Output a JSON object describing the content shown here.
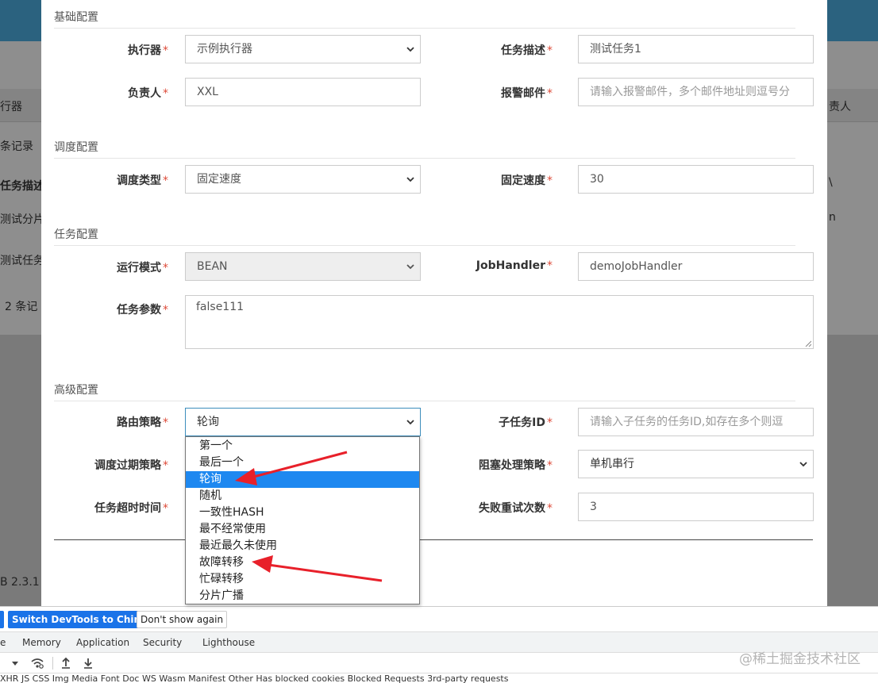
{
  "background": {
    "col_executor": "行器",
    "col_owner": "责人",
    "record_label": "条记录",
    "col_desc": "任务描述",
    "row1": "测试分片",
    "row1_right": "n",
    "row2": "测试任务",
    "row_right": "\\",
    "records_total": "2 条记",
    "version": "B 2.3.1"
  },
  "colors": {
    "accent": "#3c8dbc",
    "selected": "#1e88f0",
    "required": "#dd4b39",
    "arrow": "#e8202a"
  },
  "sections": {
    "basic": "基础配置",
    "schedule": "调度配置",
    "task": "任务配置",
    "advanced": "高级配置"
  },
  "form": {
    "executor": {
      "label": "执行器",
      "value": "示例执行器"
    },
    "task_desc": {
      "label": "任务描述",
      "value": "测试任务1"
    },
    "owner": {
      "label": "负责人",
      "value": "XXL"
    },
    "alarm_email": {
      "label": "报警邮件",
      "placeholder": "请输入报警邮件，多个邮件地址则逗号分"
    },
    "schedule_type": {
      "label": "调度类型",
      "value": "固定速度"
    },
    "fixed_rate": {
      "label": "固定速度",
      "value": "30"
    },
    "run_mode": {
      "label": "运行模式",
      "value": "BEAN"
    },
    "job_handler": {
      "label": "JobHandler",
      "value": "demoJobHandler"
    },
    "task_param": {
      "label": "任务参数",
      "value": "false111"
    },
    "route_strategy": {
      "label": "路由策略",
      "value": "轮询"
    },
    "child_job_id": {
      "label": "子任务ID",
      "placeholder": "请输入子任务的任务ID,如存在多个则逗"
    },
    "misfire_strategy": {
      "label": "调度过期策略"
    },
    "block_strategy": {
      "label": "阻塞处理策略",
      "value": "单机串行"
    },
    "timeout": {
      "label": "任务超时时间"
    },
    "fail_retry": {
      "label": "失败重试次数",
      "value": "3"
    },
    "required_mark": "*"
  },
  "route_options": [
    "第一个",
    "最后一个",
    "轮询",
    "随机",
    "一致性HASH",
    "最不经常使用",
    "最近最久未使用",
    "故障转移",
    "忙碌转移",
    "分片广播"
  ],
  "route_selected": "轮询",
  "devtools": {
    "switch_btn": "Switch DevTools to Chinese",
    "dont_show": "Don't show again",
    "tabs": [
      "e",
      "Memory",
      "Application",
      "Security",
      "Lighthouse"
    ],
    "filter_row": "XHR  JS  CSS  Img  Media  Font  Doc  WS  Wasm  Manifest  Other    Has blocked cookies    Blocked Requests    3rd-party requests"
  },
  "watermark": "@稀土掘金技术社区"
}
